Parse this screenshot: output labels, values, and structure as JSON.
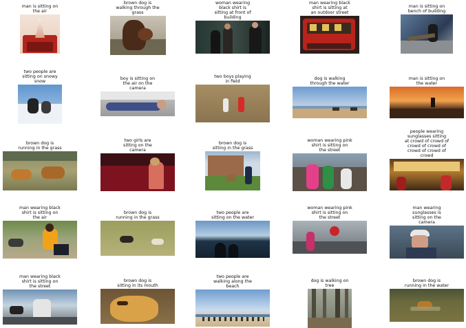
{
  "grid": [
    [
      {
        "caption": "man is sitting on\nthe air",
        "scene": "tent-red"
      },
      {
        "caption": "brown dog is\nwalking through the\ngrass",
        "scene": "dog-close"
      },
      {
        "caption": "woman wearing\nblack shirt is\nsitting at front of\nbuilding",
        "scene": "people-dark"
      },
      {
        "caption": "man wearing black\nshirt is sitting at\nan outdoor street",
        "scene": "red-tram"
      },
      {
        "caption": "man is sitting on\nbench of building",
        "scene": "bench"
      }
    ],
    [
      {
        "caption": "two people are\nsitting on snowy\nsnow",
        "scene": "snow"
      },
      {
        "caption": "boy is sitting on\nthe air on the\ncamera",
        "scene": "lying-man"
      },
      {
        "caption": "two boys playing\nin field",
        "scene": "field-kids"
      },
      {
        "caption": "dog is walking\nthrough the water",
        "scene": "beach-dogs"
      },
      {
        "caption": "man is sitting on\nthe water",
        "scene": "sunset"
      }
    ],
    [
      {
        "caption": "brown dog is\nrunning in the grass",
        "scene": "dogs-grass"
      },
      {
        "caption": "two girls are\nsitting on the\ncamera",
        "scene": "red-room"
      },
      {
        "caption": "brown dog is\nsitting in the grass",
        "scene": "house-dog"
      },
      {
        "caption": "woman wearing pink\nshirt is sitting on\nthe street",
        "scene": "crowd-street"
      },
      {
        "caption": "people wearing\nsunglasses sitting\nat crowd of crowd of\ncrowd of crowd of\ncrowd of crowd of\ncrowd",
        "scene": "market"
      }
    ],
    [
      {
        "caption": "man wearing black\nshirt is sitting on\nthe air",
        "scene": "man-dog"
      },
      {
        "caption": "brown dog is\nrunning in the grass",
        "scene": "dogs-field"
      },
      {
        "caption": "two people are\nsitting on the water",
        "scene": "lake"
      },
      {
        "caption": "woman wearing pink\nshirt is sitting on\nthe street",
        "scene": "stop-street"
      },
      {
        "caption": "man wearing\nsunglasses is\nsitting on the\ncamera",
        "scene": "old-man"
      }
    ],
    [
      {
        "caption": "man wearing black\nshirt is sitting on\nthe street",
        "scene": "photographer"
      },
      {
        "caption": "brown dog is\nsitting in its mouth",
        "scene": "sleepy-dog"
      },
      {
        "caption": "two people are\nwalking along the\nbeach",
        "scene": "beach-crowd"
      },
      {
        "caption": "dog is walking on\ntree",
        "scene": "forest"
      },
      {
        "caption": "brown dog is\nrunning in the water",
        "scene": "dog-water"
      }
    ]
  ]
}
